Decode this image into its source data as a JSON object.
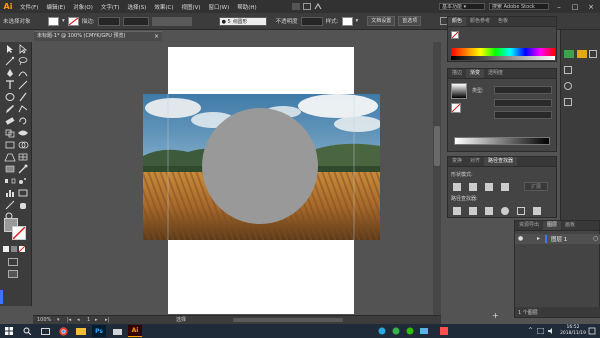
{
  "app": {
    "logo": "Ai"
  },
  "menu": [
    "文件(F)",
    "编辑(E)",
    "对象(O)",
    "文字(T)",
    "选择(S)",
    "效果(C)",
    "视图(V)",
    "窗口(W)",
    "帮助(H)"
  ],
  "workspace": {
    "label": "基本功能",
    "search_placeholder": "搜索 Adobe Stock"
  },
  "control_bar": {
    "selection_label": "未选择对象",
    "stroke_label": "描边:",
    "stroke_value": "",
    "brush_value": "5 点圆形",
    "opacity_label": "不透明度",
    "style_label": "样式:",
    "doc_setup": "文档设置",
    "preferences": "首选项"
  },
  "document": {
    "tab_title": "未标题-1* @ 100% (CMYK/GPU 预览)",
    "close_glyph": "×"
  },
  "status": {
    "zoom": "100%",
    "page": "1",
    "tool": "选择"
  },
  "panels": {
    "color": {
      "tabs": [
        "颜色",
        "颜色参考",
        "色板"
      ]
    },
    "gradient": {
      "tabs": [
        "描边",
        "渐变",
        "透明度"
      ],
      "type_label": "类型:"
    },
    "pathfinder": {
      "tabs": [
        "变换",
        "对齐",
        "路径查找器"
      ],
      "shape_mode_label": "形状模式:",
      "expand_button": "扩展",
      "pathfinder_label": "路径查找器:"
    },
    "layers": {
      "tabs": [
        "资源导出",
        "图层",
        "画板"
      ],
      "layer_name": "图层 1",
      "count_label": "1 个图层"
    }
  },
  "taskbar": {
    "time": "16:52",
    "date": "2018/11/19"
  },
  "colors": {
    "accent": "#ff9a00",
    "menubar_bg": "#323232",
    "panel_bg": "#444444",
    "canvas_bg": "#535353",
    "circle_fill": "#999999",
    "layer_color": "#3f74ff"
  },
  "icons": [
    "selection-icon",
    "direct-selection-icon",
    "magic-wand-icon",
    "lasso-icon",
    "pen-icon",
    "curvature-icon",
    "type-icon",
    "line-icon",
    "rectangle-icon",
    "paintbrush-icon",
    "pencil-icon",
    "shaper-icon",
    "eraser-icon",
    "rotate-icon",
    "scale-icon",
    "width-icon",
    "free-transform-icon",
    "shape-builder-icon",
    "perspective-icon",
    "mesh-icon",
    "gradient-icon",
    "eyedropper-icon",
    "blend-icon",
    "symbol-sprayer-icon",
    "column-graph-icon",
    "artboard-icon",
    "slice-icon",
    "hand-icon",
    "zoom-icon"
  ]
}
